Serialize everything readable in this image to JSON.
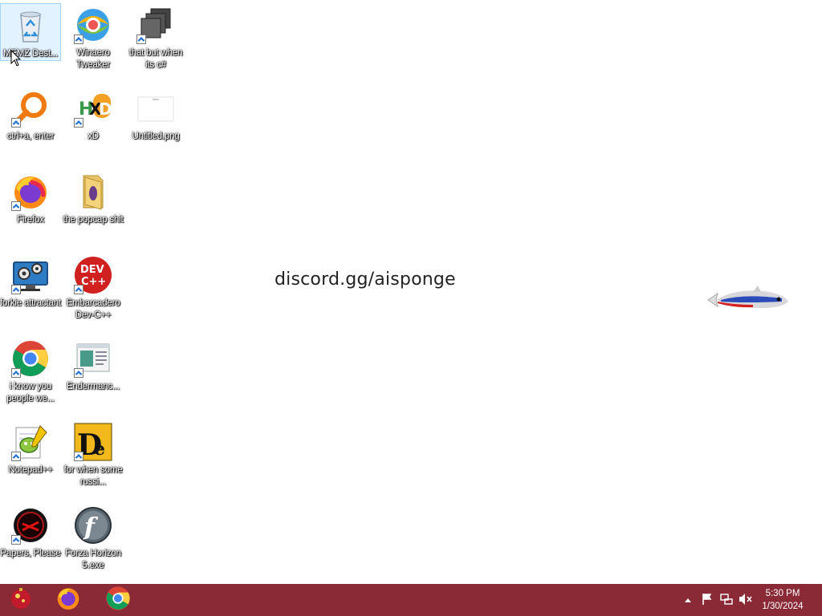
{
  "desktop": {
    "watermark": "discord.gg/aisponge",
    "icons": [
      {
        "label": "MEMZ Dest...",
        "icon": "recycle-bin-icon"
      },
      {
        "label": "Winaero Tweaker",
        "icon": "winaero-icon"
      },
      {
        "label": "that but when its c#",
        "icon": "stacked-windows-icon"
      },
      {
        "label": "ctrl+a, enter",
        "icon": "magnifier-icon"
      },
      {
        "label": "xD",
        "icon": "hxd-icon"
      },
      {
        "label": "Untitled.png",
        "icon": "image-file-icon"
      },
      {
        "label": "Firefox",
        "icon": "firefox-icon"
      },
      {
        "label": "the popcap shit",
        "icon": "folder-icon"
      },
      {
        "label": "forkie attractant",
        "icon": "computer-settings-icon"
      },
      {
        "label": "Embarcadero Dev-C++",
        "icon": "devcpp-icon"
      },
      {
        "label": "i know you people we...",
        "icon": "chrome-icon"
      },
      {
        "label": "Endermanc...",
        "icon": "window-app-icon"
      },
      {
        "label": "Notepad++",
        "icon": "notepadpp-icon"
      },
      {
        "label": "for when some russi...",
        "icon": "de-icon"
      },
      {
        "label": "Papers, Please",
        "icon": "papers-please-icon"
      },
      {
        "label": "Forza Horizon 5.exe",
        "icon": "flash-icon"
      }
    ]
  },
  "taskbar": {
    "pinned": [
      "start-button-icon",
      "firefox-icon",
      "chrome-icon"
    ],
    "tray": [
      "show-hidden-icons-chevron",
      "action-center-flag-icon",
      "network-icon",
      "volume-muted-icon"
    ],
    "time": "5:30 PM",
    "date": "1/30/2024",
    "color": "#8b2a37"
  }
}
